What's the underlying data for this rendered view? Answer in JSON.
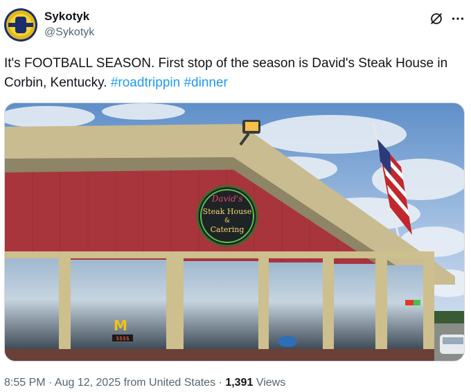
{
  "tweet": {
    "author_name": "Sykotyk",
    "author_handle": "@Sykotyk",
    "text_main": "It's FOOTBALL SEASON. First stop of the season is David's Steak House in Corbin, Kentucky.",
    "hashtags": [
      "#roadtrippin",
      "#dinner"
    ],
    "timestamp": "8:55 PM · Aug 12, 2025",
    "source": "from United States",
    "views_count": "1,391",
    "views_label": "Views"
  },
  "photo": {
    "sign_line1": "David's",
    "sign_line2": "Steak House",
    "sign_line3": "&",
    "sign_line4": "Catering",
    "mcd_price": "$$$$"
  },
  "icons": {
    "grok": "grok-icon",
    "more": "more-icon"
  },
  "colors": {
    "link": "#1d9bf0",
    "secondary_text": "#536471",
    "primary_text": "#0f1419",
    "building_red": "#a8353c",
    "trim_tan": "#cdbf8e"
  }
}
